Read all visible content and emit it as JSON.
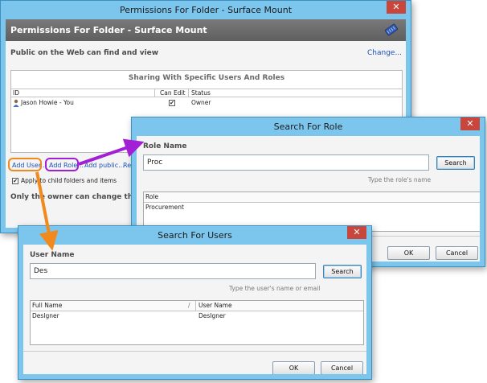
{
  "colors": {
    "window_frame": "#7cc6ee",
    "close_button": "#c9463d",
    "banner": "#6c6c6c",
    "link": "#1c4fb8",
    "highlight_orange": "#f08a1e",
    "highlight_purple": "#a21fd6"
  },
  "permissions": {
    "title": "Permissions For Folder - Surface Mount",
    "banner_title": "Permissions For Folder - Surface Mount",
    "public_text": "Public on the Web can find and view",
    "change_link": "Change...",
    "sharing_header": "Sharing With Specific Users And Roles",
    "columns": [
      "ID",
      "Can Edit",
      "Status"
    ],
    "rows": [
      {
        "id": "Jason Howie - You",
        "can_edit": "✔",
        "status": "Owner"
      }
    ],
    "add_user": "Add User...",
    "add_role": "Add Role...",
    "add_public": "Add public...",
    "cut_link": "Re",
    "apply_child": "Apply to child folders and items",
    "apply_child_checked": "✔",
    "owner_note": "Only the owner can change th",
    "close_glyph": "✕"
  },
  "role_dialog": {
    "title": "Search For Role",
    "caption": "Role Name",
    "input_value": "Proc",
    "search_button": "Search",
    "hint": "Type the role's name",
    "column": "Role",
    "results": [
      "Procurement"
    ],
    "ok": "OK",
    "cancel": "Cancel",
    "close_glyph": "✕"
  },
  "user_dialog": {
    "title": "Search For Users",
    "caption": "User Name",
    "input_value": "Des",
    "search_button": "Search",
    "hint": "Type the user's name or email",
    "columns": [
      "Full Name",
      "User Name"
    ],
    "sort_indicator": "/",
    "results": [
      {
        "full_name": "DesIgner",
        "user_name": "DesIgner"
      }
    ],
    "ok": "OK",
    "cancel": "Cancel",
    "close_glyph": "✕"
  }
}
